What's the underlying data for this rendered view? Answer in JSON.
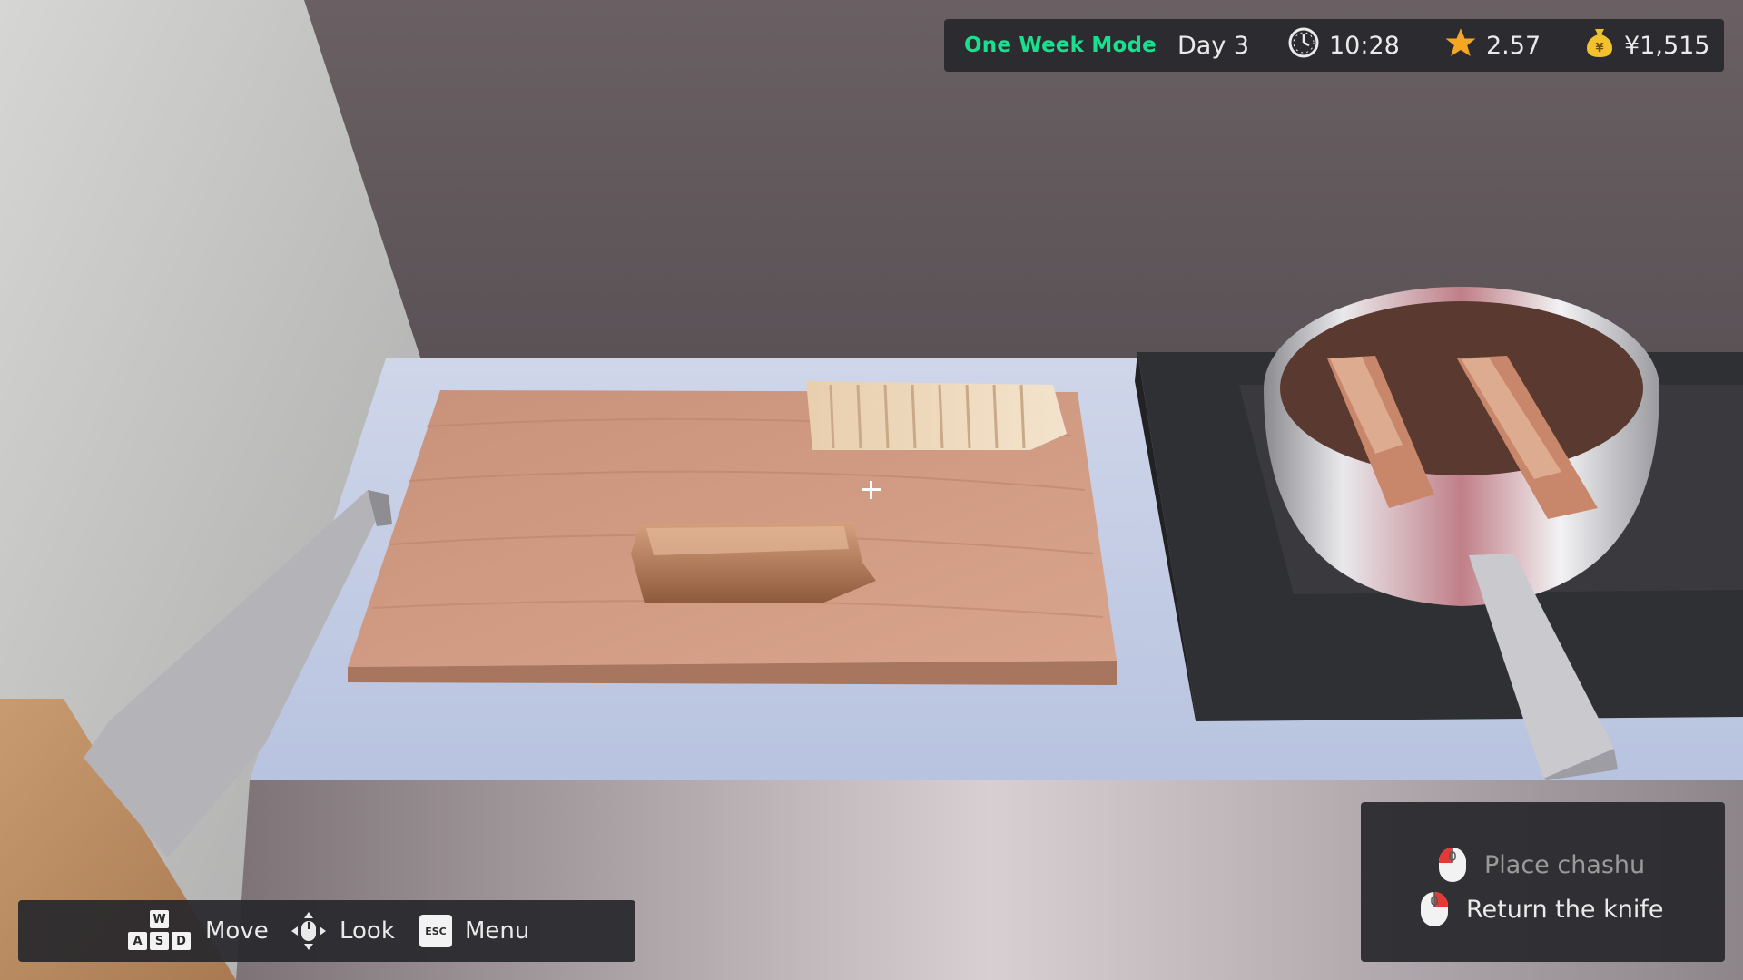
{
  "hud": {
    "mode": "One Week Mode",
    "day": "Day 3",
    "time": "10:28",
    "rating": "2.57",
    "money": "¥1,515"
  },
  "controls": [
    {
      "label": "Move",
      "icon": "wasd-keys-icon",
      "keys": [
        "W",
        "A",
        "S",
        "D"
      ]
    },
    {
      "label": "Look",
      "icon": "mouse-move-icon"
    },
    {
      "label": "Menu",
      "icon": "esc-key-icon",
      "key": "ESC"
    }
  ],
  "actions": [
    {
      "label": "Place chashu",
      "icon": "mouse-left-click-icon",
      "enabled": false
    },
    {
      "label": "Return the knife",
      "icon": "mouse-right-click-icon",
      "enabled": true
    }
  ],
  "colors": {
    "mode_accent": "#19e08f",
    "star": "#f5a623",
    "coin": "#f2c12e",
    "mouse_button": "#e53935"
  }
}
